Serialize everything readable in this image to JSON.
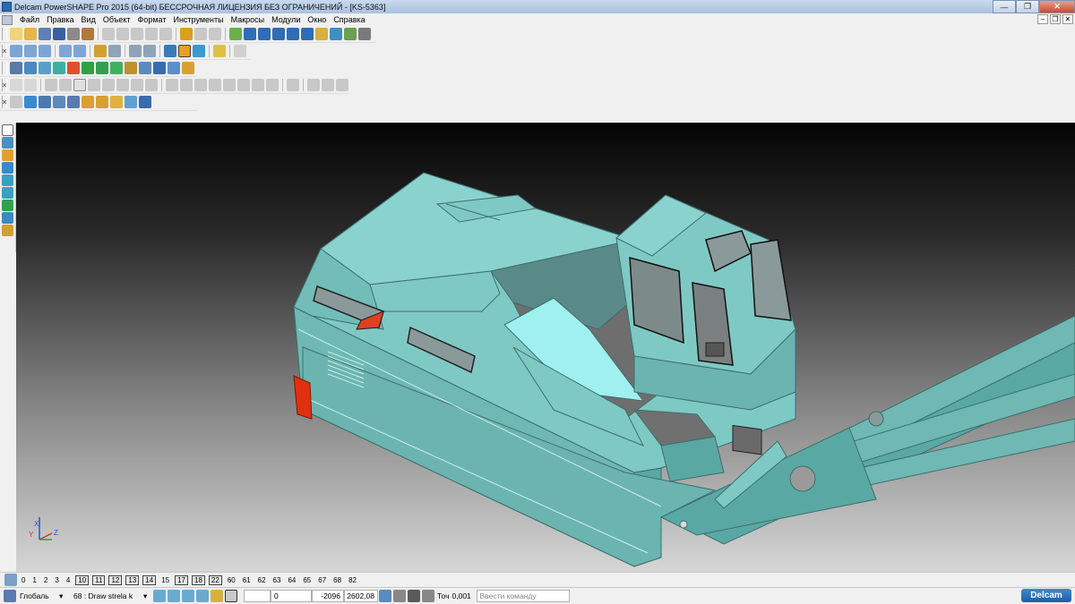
{
  "window": {
    "title": "Delcam PowerSHAPE Pro 2015 (64-bit) БЕССРОЧНАЯ ЛИЦЕНЗИЯ БЕЗ ОГРАНИЧЕНИЙ - [KS-5363]",
    "minimize": "—",
    "maximize": "❐",
    "close": "✕"
  },
  "menu": {
    "items": [
      "Файл",
      "Правка",
      "Вид",
      "Объект",
      "Формат",
      "Инструменты",
      "Макросы",
      "Модули",
      "Окно",
      "Справка"
    ]
  },
  "viewport": {
    "triad": {
      "x": "X",
      "y": "Y",
      "z": "Z"
    }
  },
  "workplanes": {
    "items": [
      {
        "label": "0",
        "boxed": false
      },
      {
        "label": "1",
        "boxed": false
      },
      {
        "label": "2",
        "boxed": false
      },
      {
        "label": "3",
        "boxed": false
      },
      {
        "label": "4",
        "boxed": false
      },
      {
        "label": "10",
        "boxed": true
      },
      {
        "label": "11",
        "boxed": true
      },
      {
        "label": "12",
        "boxed": true
      },
      {
        "label": "13",
        "boxed": true
      },
      {
        "label": "14",
        "boxed": true
      },
      {
        "label": "15",
        "boxed": false
      },
      {
        "label": "17",
        "boxed": true
      },
      {
        "label": "18",
        "boxed": true
      },
      {
        "label": "22",
        "boxed": true
      },
      {
        "label": "60",
        "boxed": false
      },
      {
        "label": "61",
        "boxed": false
      },
      {
        "label": "62",
        "boxed": false
      },
      {
        "label": "63",
        "boxed": false
      },
      {
        "label": "64",
        "boxed": false
      },
      {
        "label": "65",
        "boxed": false
      },
      {
        "label": "67",
        "boxed": false
      },
      {
        "label": "68",
        "boxed": false
      },
      {
        "label": "82",
        "boxed": false
      }
    ]
  },
  "status": {
    "coord_system": "Глобаль",
    "level": "68 : Draw strela k",
    "x": "0",
    "y": "-2096",
    "z": "2602,08",
    "tol_label": "Точ",
    "tolerance": "0,001",
    "command_placeholder": "Ввести команду",
    "logo": "Delcam"
  },
  "colors": {
    "body": "#7fc9c4",
    "body_dark": "#5aa8a4",
    "accent_red": "#e0401e",
    "window_glass": "#8a9a9a"
  }
}
